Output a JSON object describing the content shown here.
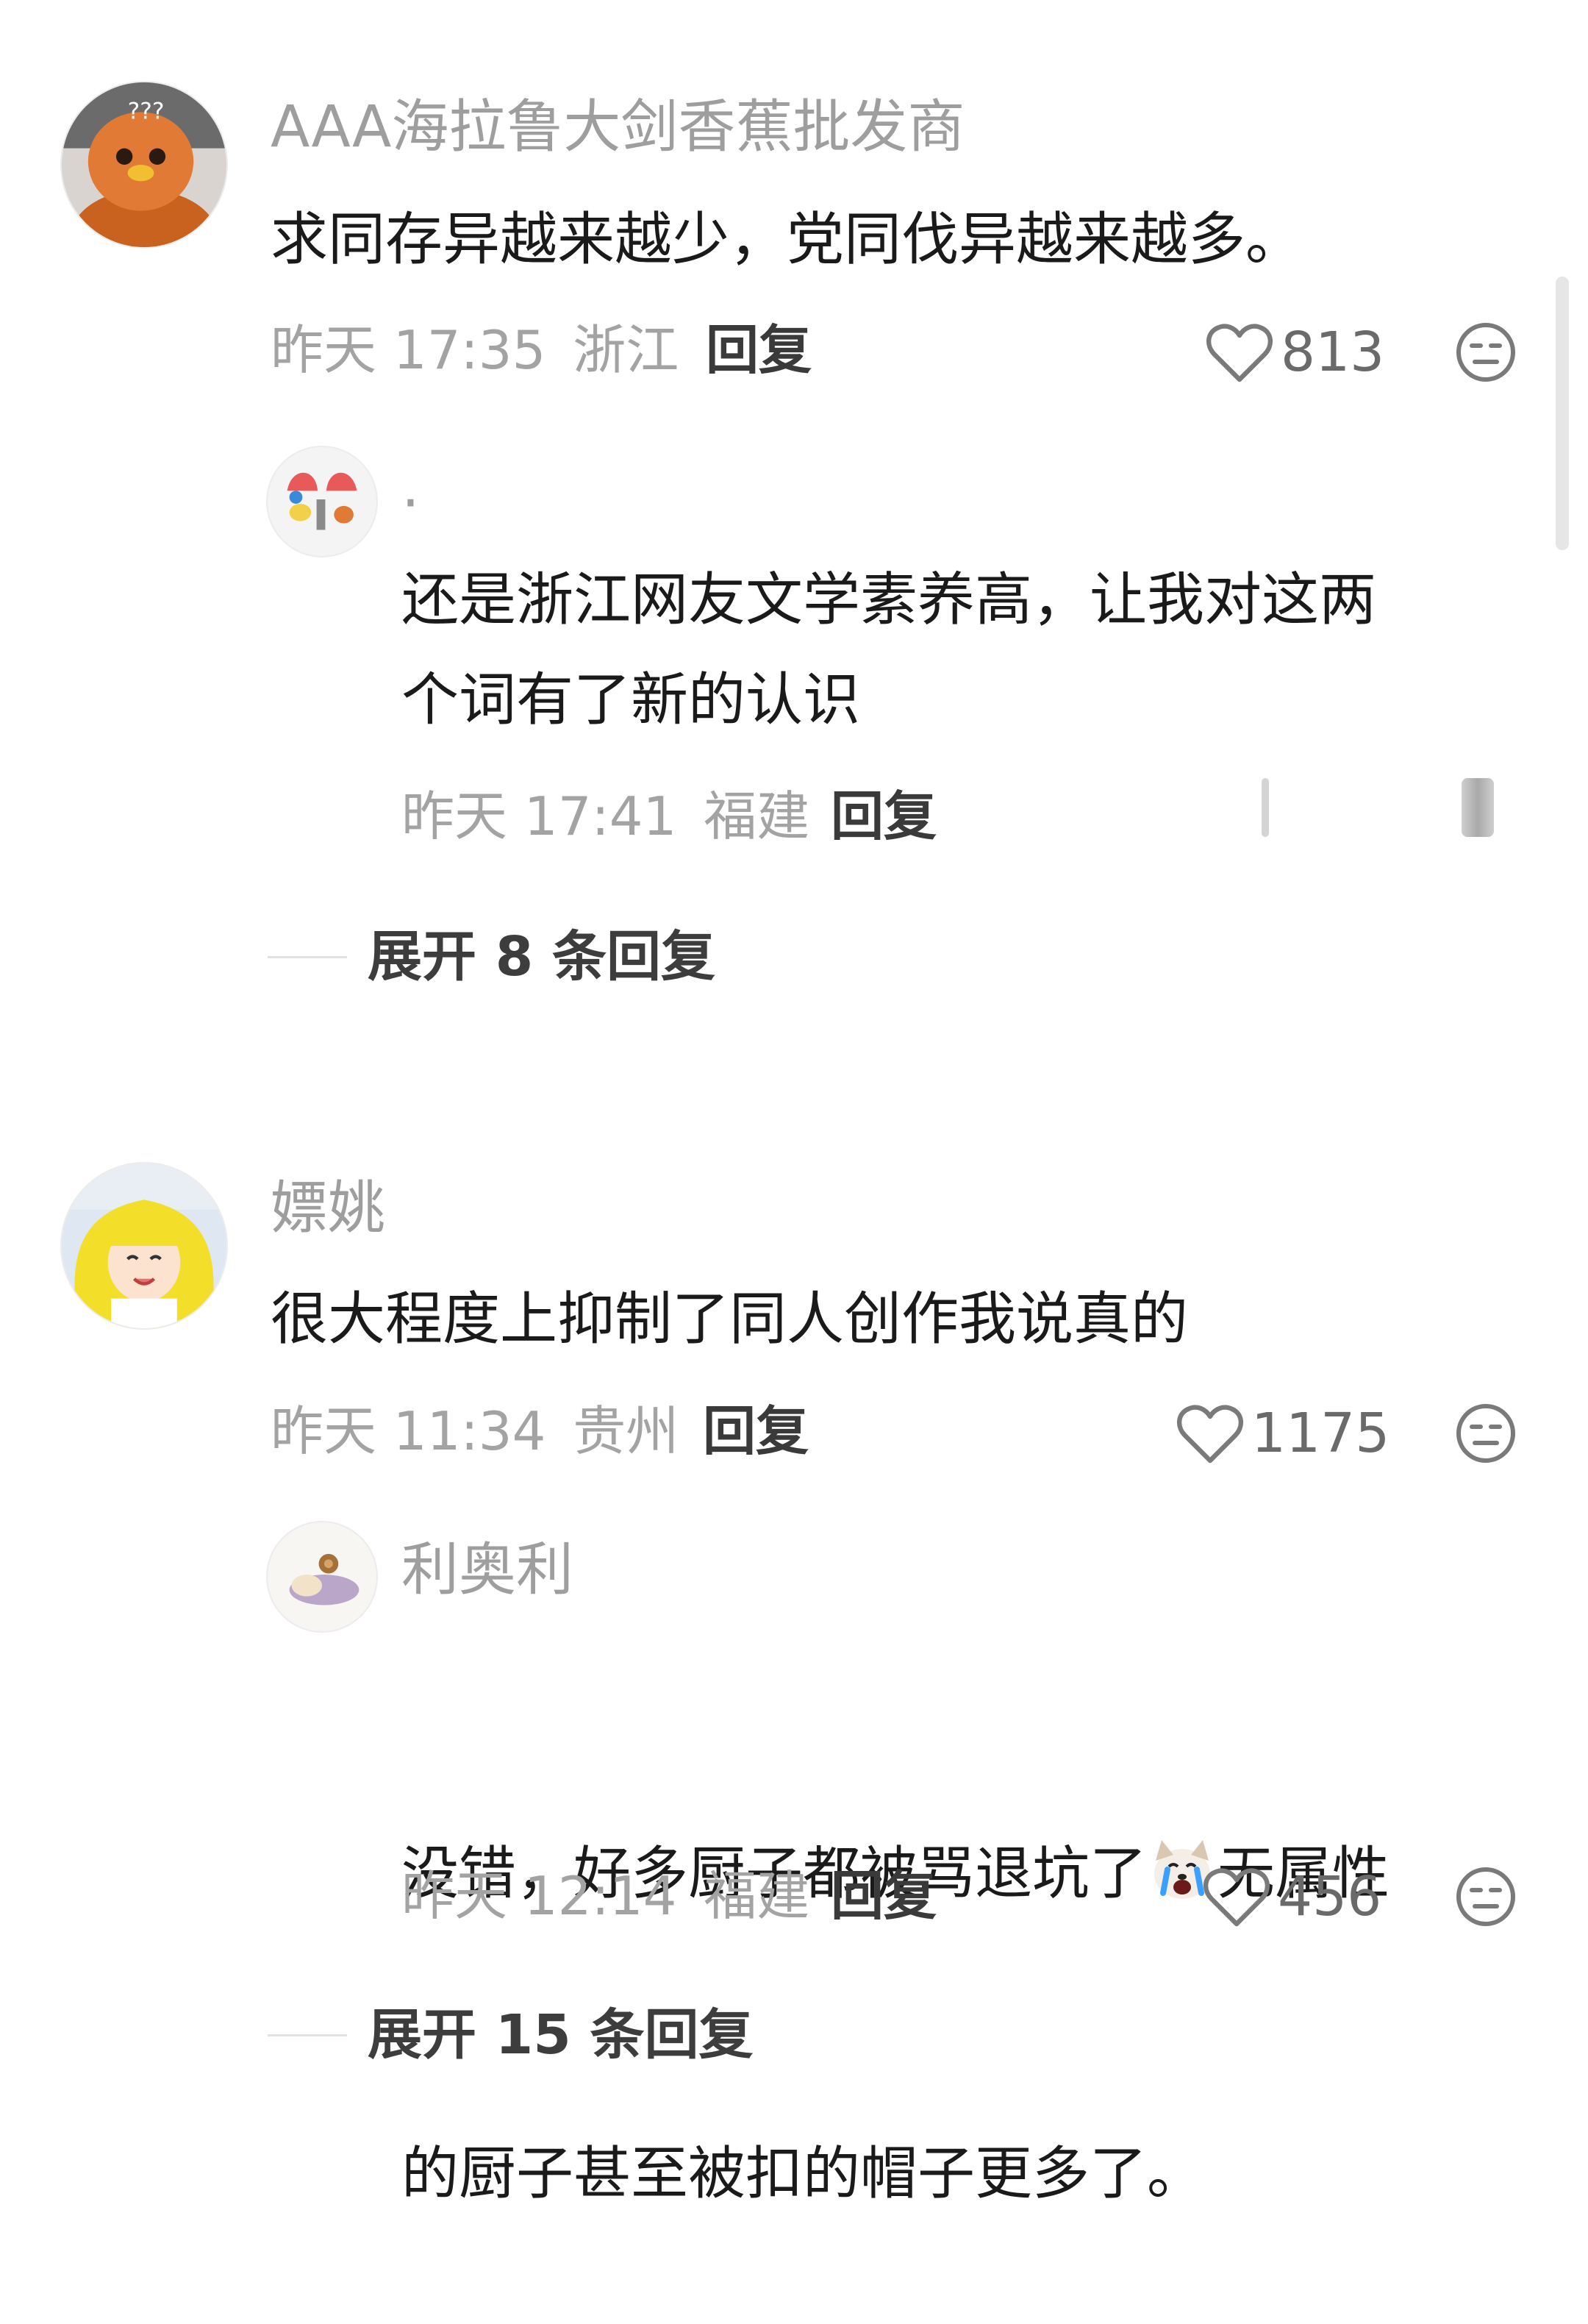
{
  "comments": [
    {
      "username": "AAA海拉鲁大剑香蕉批发商",
      "avatar_icon": "orange-bird-mascot-avatar",
      "text": "求同存异越来越少，党同伐异越来越多。",
      "time": "昨天 17:35",
      "location": "浙江",
      "reply_label": "回复",
      "likes": "813",
      "replies": [
        {
          "username": "·",
          "avatar_icon": "cartoon-characters-avatar",
          "text": "还是浙江网友文学素养高，让我对这两\n个词有了新的认识",
          "time": "昨天 17:41",
          "location": "福建",
          "reply_label": "回复"
        }
      ],
      "expand_label": "展开 8 条回复"
    },
    {
      "username": "嫖姚",
      "avatar_icon": "anime-girl-yellow-hair-avatar",
      "text": "很大程度上抑制了同人创作我说真的",
      "time": "昨天 11:34",
      "location": "贵州",
      "reply_label": "回复",
      "likes": "1175",
      "replies": [
        {
          "username": "利奥利",
          "avatar_icon": "cat-sleeping-avatar",
          "text_before_emoji": "没错，好多厨子都被骂退坑了",
          "emoji_icon": "crying-dog-emoji",
          "text_after_emoji": "无属性",
          "text_line2": "的厨子甚至被扣的帽子更多了。",
          "time": "昨天 12:14",
          "location": "福建",
          "reply_label": "回复",
          "likes": "456"
        }
      ],
      "expand_label": "展开 15 条回复"
    }
  ],
  "colors": {
    "username": "#9e9e9e",
    "body_text": "#1a1a1a",
    "meta": "#a3a3a3",
    "icon": "#7a7a7a"
  }
}
